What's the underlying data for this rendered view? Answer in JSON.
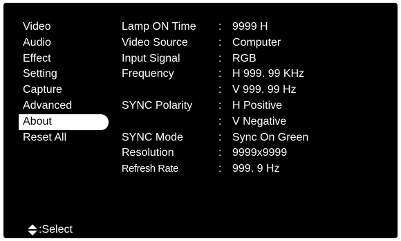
{
  "menu": {
    "items": [
      "Video",
      "Audio",
      "Effect",
      "Setting",
      "Capture",
      "Advanced",
      "About",
      "Reset All"
    ],
    "selected_index": 6
  },
  "about": {
    "rows": [
      {
        "label": "Lamp ON Time",
        "value": "9999 H"
      },
      {
        "label": "Video Source",
        "value": "Computer"
      },
      {
        "label": "Input Signal",
        "value": "RGB"
      },
      {
        "label": "Frequency",
        "value": "H 999. 99 KHz"
      },
      {
        "label": "",
        "value": "V 999. 99 Hz"
      },
      {
        "label": "SYNC Polarity",
        "value": "H Positive"
      },
      {
        "label": "",
        "value": "V Negative"
      },
      {
        "label": "SYNC Mode",
        "value": "Sync On Green"
      },
      {
        "label": "Resolution",
        "value": "9999x9999"
      },
      {
        "label": "Refresh Rate",
        "value": "999. 9 Hz"
      }
    ],
    "separator": ":"
  },
  "footer": {
    "icon": "up-down-arrow-icon",
    "text": ":Select"
  }
}
